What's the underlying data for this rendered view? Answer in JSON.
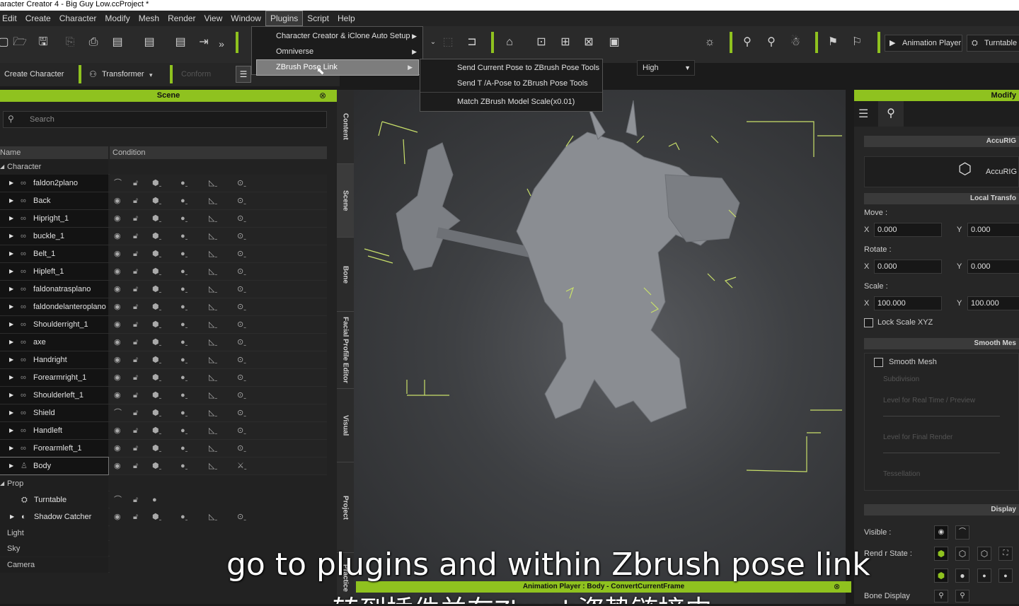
{
  "window": {
    "title": "aracter Creator 4 - Big Guy Low.ccProject *"
  },
  "menu": [
    "Edit",
    "Create",
    "Character",
    "Modify",
    "Mesh",
    "Render",
    "View",
    "Window",
    "Plugins",
    "Script",
    "Help"
  ],
  "toolbar": {
    "quality": "High",
    "animation_player": "Animation Player",
    "turntable": "Turntable"
  },
  "subbar": {
    "create_character": "Create Character",
    "transformer": "Transformer",
    "conform": "Conform"
  },
  "plugins_menu": {
    "items": [
      {
        "label": "Character Creator & iClone Auto Setup"
      },
      {
        "label": "Omniverse"
      },
      {
        "label": "ZBrush Pose Link"
      }
    ],
    "zbrush_submenu": [
      "Send Current Pose to  ZBrush Pose Tools",
      "Send T /A-Pose to  ZBrush Pose Tools",
      "Match ZBrush Model Scale(x0.01)"
    ]
  },
  "scene": {
    "title": "Scene",
    "search_placeholder": "Search",
    "columns": {
      "name": "Name",
      "condition": "Condition"
    },
    "character_label": "Character",
    "items": [
      "faldon2plano",
      "Back",
      "Hipright_1",
      "buckle_1",
      "Belt_1",
      "Hipleft_1",
      "faldonatrasplano",
      "faldondelanteroplano",
      "Shoulderright_1",
      "axe",
      "Handright",
      "Forearmright_1",
      "Shoulderleft_1",
      "Shield",
      "Handleft",
      "Forearmleft_1",
      "Body"
    ],
    "prop_label": "Prop",
    "props": [
      "Turntable",
      "Shadow Catcher"
    ],
    "others": [
      "Light",
      "Sky",
      "Camera"
    ]
  },
  "side_tabs": [
    "Content",
    "Scene",
    "Bone",
    "Facial Profile Editor",
    "Visual",
    "Project",
    "Practice"
  ],
  "modify": {
    "title": "Modify",
    "accurig_section": "AccuRIG",
    "accurig_button": "AccuRIG",
    "local_transform": "Local Transfo",
    "move": "Move :",
    "move_x": "0.000",
    "move_y": "0.000",
    "rotate": "Rotate :",
    "rotate_x": "0.000",
    "rotate_y": "0.000",
    "scale": "Scale :",
    "scale_x": "100.000",
    "scale_y": "100.000",
    "lock_scale": "Lock Scale XYZ",
    "smooth_section": "Smooth Mes",
    "smooth_mesh": "Smooth Mesh",
    "subdivision": "Subdivision",
    "level_realtime": "Level for Real Time / Preview",
    "level_final": "Level for Final Render",
    "tessellation": "Tessellation",
    "display_section": "Display",
    "visible": "Visible :",
    "render_state": "Rend  r State :",
    "bone_display": "Bone Display"
  },
  "animation_player_bar": "Animation Player : Body - ConvertCurrentFrame",
  "subtitles": {
    "en": "go to plugins and within Zbrush pose link",
    "cn": "转到插件并在Zbrush姿势链接中"
  }
}
